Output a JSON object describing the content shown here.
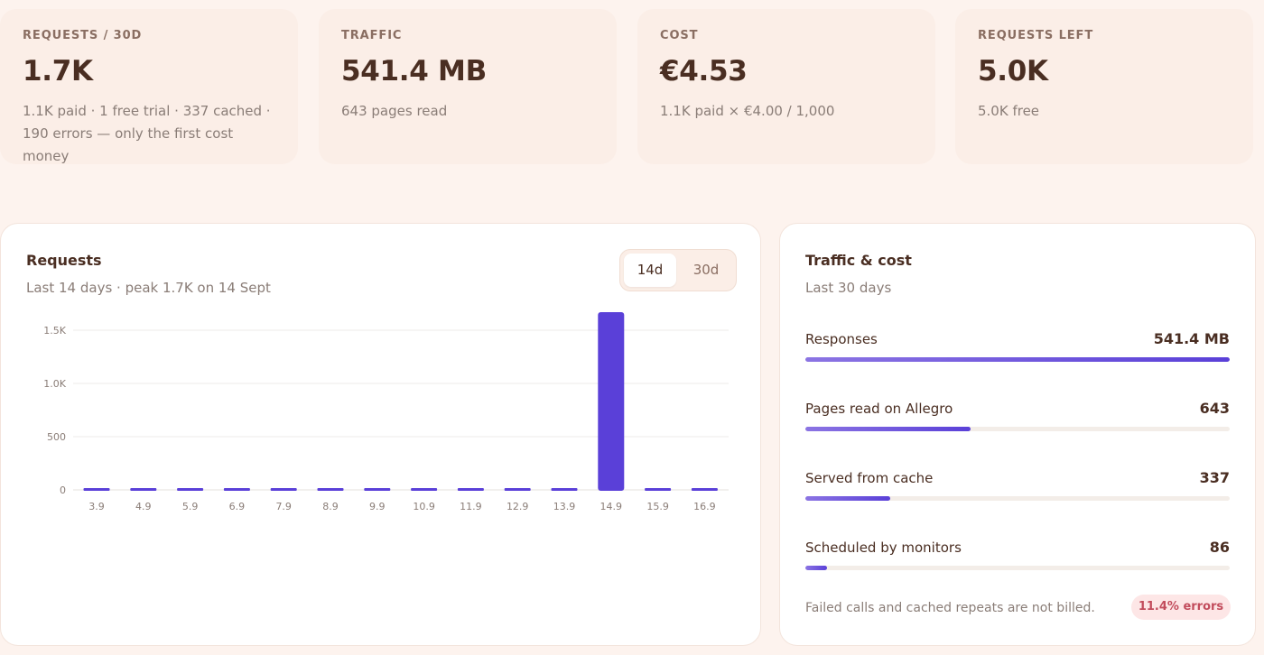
{
  "stats": [
    {
      "label": "REQUESTS / 30D",
      "value": "1.7K",
      "note_line1": "1.1K paid · 1 free trial · 337 cached ·",
      "note_line2": "190 errors — only the first cost money"
    },
    {
      "label": "TRAFFIC",
      "value": "541.4 MB",
      "note_line1": "643 pages read",
      "note_line2": ""
    },
    {
      "label": "COST",
      "value": "€4.53",
      "note_line1": "1.1K paid × €4.00 / 1,000",
      "note_line2": ""
    },
    {
      "label": "REQUESTS LEFT",
      "value": "5.0K",
      "note_line1": "5.0K free",
      "note_line2": ""
    }
  ],
  "requests_panel": {
    "title": "Requests",
    "subtitle": "Last 14 days · peak 1.7K on 14 Sept",
    "toggle": {
      "option_14d": "14d",
      "option_30d": "30d",
      "selected": "14d"
    }
  },
  "chart_data": {
    "type": "bar",
    "categories": [
      "3.9",
      "4.9",
      "5.9",
      "6.9",
      "7.9",
      "8.9",
      "9.9",
      "10.9",
      "11.9",
      "12.9",
      "13.9",
      "14.9",
      "15.9",
      "16.9"
    ],
    "values": [
      0,
      0,
      0,
      0,
      0,
      0,
      0,
      0,
      0,
      0,
      0,
      1670,
      5,
      0
    ],
    "yticks": [
      0,
      500,
      1000,
      1500
    ],
    "ytick_labels": [
      "0",
      "500",
      "1.0K",
      "1.5K"
    ],
    "ylim": [
      0,
      1700
    ],
    "grid": true,
    "bar_color": "#5a40d8"
  },
  "traffic_panel": {
    "title": "Traffic & cost",
    "subtitle": "Last 30 days",
    "metrics": [
      {
        "label": "Responses",
        "value": "541.4 MB",
        "fraction": 1.0
      },
      {
        "label": "Pages read on Allegro",
        "value": "643",
        "fraction": 0.39
      },
      {
        "label": "Served from cache",
        "value": "337",
        "fraction": 0.2
      },
      {
        "label": "Scheduled by monitors",
        "value": "86",
        "fraction": 0.05
      }
    ],
    "footnote": "Failed calls and cached repeats are not billed.",
    "error_badge": "11.4% errors"
  }
}
